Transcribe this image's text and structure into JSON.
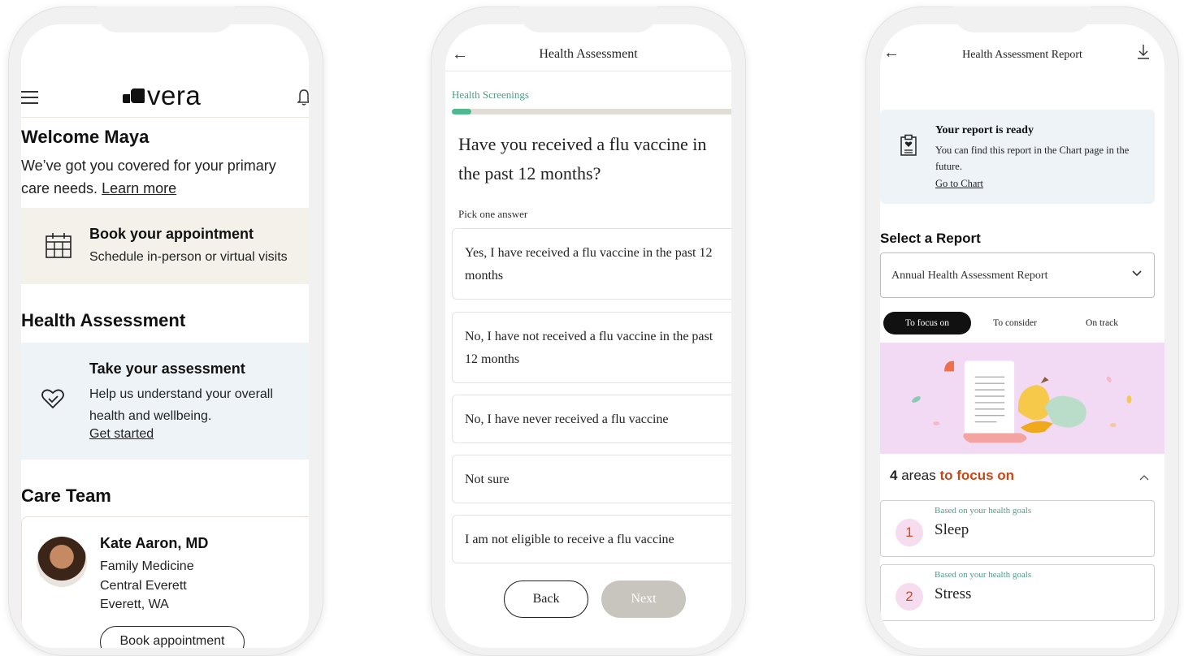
{
  "phone1": {
    "logo": "vera",
    "welcome_title": "Welcome Maya",
    "welcome_text": "We’ve got you covered for your primary care needs.",
    "welcome_link": "Learn more",
    "book_card": {
      "title": "Book your appointment",
      "subtitle": "Schedule in-person or virtual visits"
    },
    "assessment_title": "Health Assessment",
    "assessment_card": {
      "title": "Take your assessment",
      "subtitle": "Help us understand your overall health and wellbeing.",
      "link": "Get started"
    },
    "care_team_title": "Care Team",
    "doctor": {
      "name": "Kate Aaron, MD",
      "specialty": "Family Medicine",
      "location": "Central Everett",
      "city": "Everett, WA"
    },
    "book_button": "Book appointment",
    "icons": [
      "menu-icon",
      "vera-logo-icon",
      "bell-icon",
      "calendar-icon",
      "heart-check-icon"
    ]
  },
  "phone2": {
    "title": "Health Assessment",
    "section": "Health Screenings",
    "progress_fraction": 0.07,
    "question": "Have you received a flu vaccine in the past 12 months?",
    "pick_label": "Pick one answer",
    "options": [
      "Yes, I have received a flu vaccine in the past 12 months",
      "No, I have not received a flu vaccine in the past 12 months",
      "No, I have never received a flu vaccine",
      "Not sure",
      "I am not eligible to receive a flu vaccine"
    ],
    "back_label": "Back",
    "next_label": "Next",
    "colors": {
      "accent": "#4fb88f",
      "disabled": "#c8c5bf"
    }
  },
  "phone3": {
    "title": "Health Assessment Report",
    "ready_card": {
      "title": "Your report is ready",
      "text": "You can find this report in the Chart page in the future.",
      "link": "Go to Chart"
    },
    "select_title": "Select a Report",
    "selected_report": "Annual Health Assessment Report",
    "tabs": [
      "To focus on",
      "To consider",
      "On track"
    ],
    "active_tab": "To focus on",
    "areas_count": "4",
    "areas_text": "areas",
    "areas_accent": "to focus on",
    "areas": [
      {
        "number": "1",
        "based_on": "Based on your health goals",
        "name": "Sleep"
      },
      {
        "number": "2",
        "based_on": "Based on your health goals",
        "name": "Stress"
      }
    ],
    "colors": {
      "accent": "#c74716",
      "illustration_bg": "#f2daf5",
      "card_bg": "#eef3f8"
    }
  }
}
